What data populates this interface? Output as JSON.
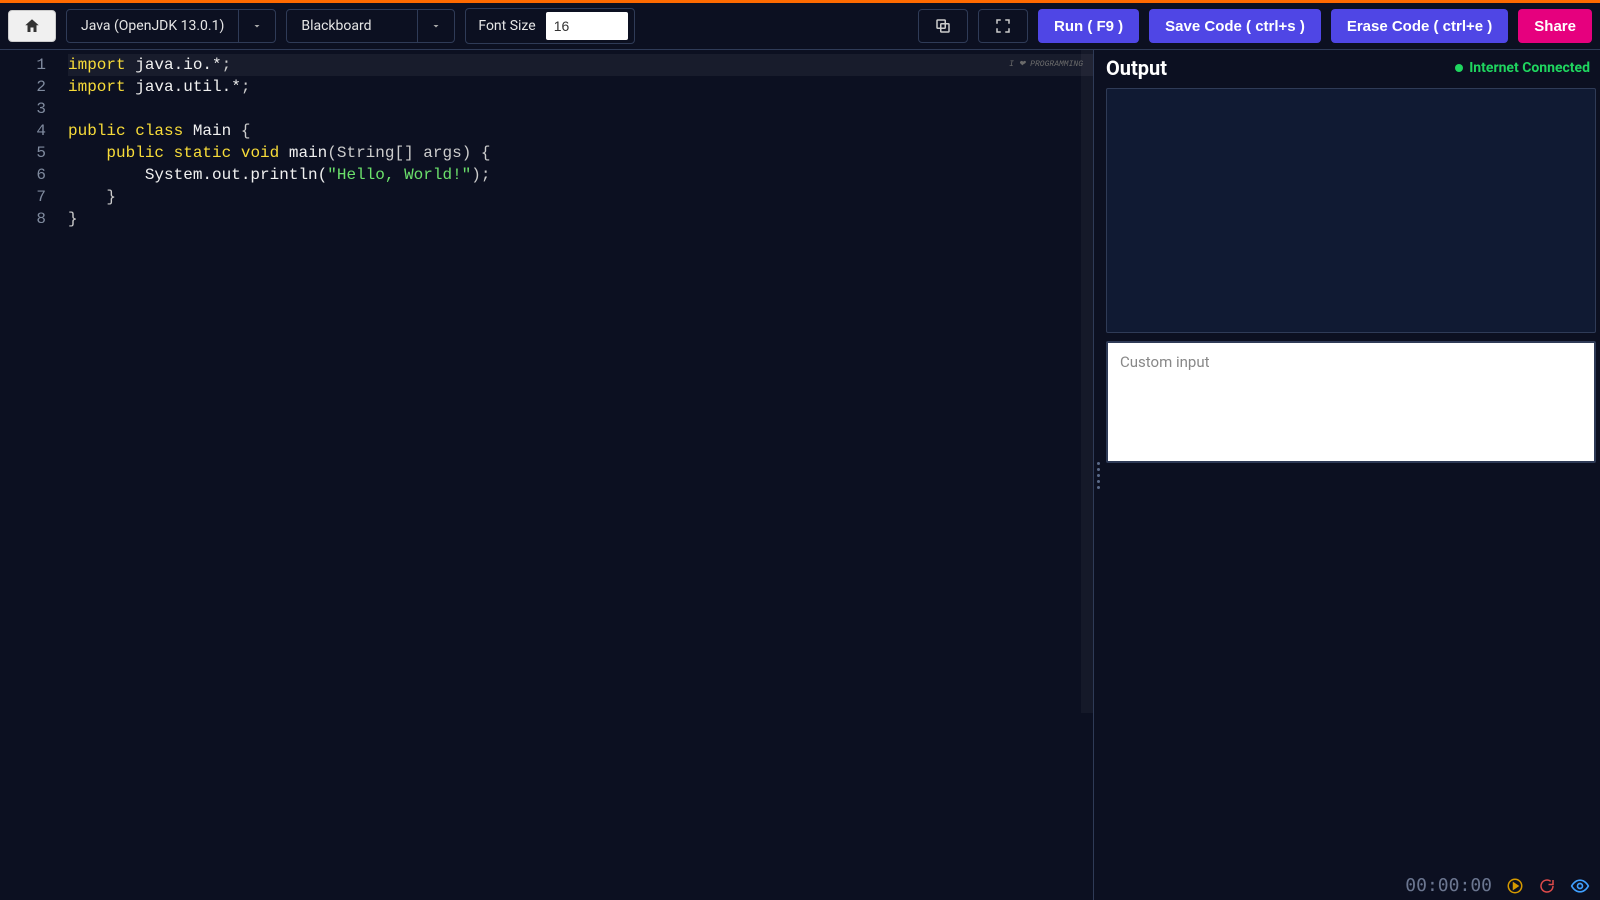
{
  "toolbar": {
    "language": "Java (OpenJDK 13.0.1)",
    "theme": "Blackboard",
    "font_size_label": "Font Size",
    "font_size_value": "16",
    "run_label": "Run ( F9 )",
    "save_label": "Save Code ( ctrl+s )",
    "erase_label": "Erase Code ( ctrl+e )",
    "share_label": "Share"
  },
  "editor": {
    "line_count": 8,
    "lines": {
      "l1_kw": "import ",
      "l1_pkg": "java.io.*",
      "l1_sc": ";",
      "l2_kw": "import ",
      "l2_pkg": "java.util.*",
      "l2_sc": ";",
      "l4_kw1": "public ",
      "l4_kw2": "class ",
      "l4_cls": "Main ",
      "l4_br": "{",
      "l5_pad": "    ",
      "l5_kw1": "public ",
      "l5_kw2": "static ",
      "l5_kw3": "void ",
      "l5_id": "main",
      "l5_args": "(String[] args) {",
      "l6_pad": "        ",
      "l6_call": "System.out.println(",
      "l6_str": "\"Hello, World!\"",
      "l6_end": ");",
      "l7_pad": "    ",
      "l7_br": "}",
      "l8_br": "}"
    },
    "watermark": "I ❤ PROGRAMMING"
  },
  "output": {
    "title": "Output",
    "status_text": "Internet Connected",
    "custom_input_placeholder": "Custom input"
  },
  "footer": {
    "timer": "00:00:00"
  }
}
